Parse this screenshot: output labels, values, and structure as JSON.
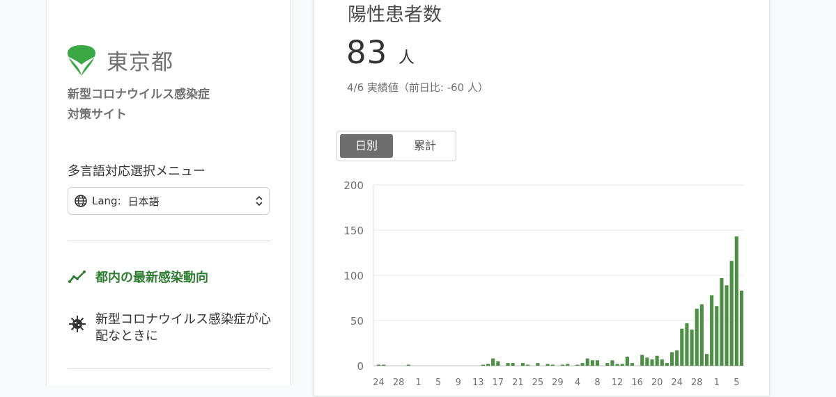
{
  "sidebar": {
    "logo_text": "東京都",
    "site_title_line1": "新型コロナウイルス感染症",
    "site_title_line2": "対策サイト",
    "lang_menu_label": "多言語対応選択メニュー",
    "lang_prefix": "Lang:",
    "lang_value": "日本語",
    "nav_items": [
      {
        "label": "都内の最新感染動向",
        "icon": "trend-line-icon",
        "active": true
      },
      {
        "label": "新型コロナウイルス感染症が心配なときに",
        "icon": "virus-icon",
        "active": false
      }
    ],
    "colors": {
      "logo_green": "#3aa845",
      "active_green": "#2e7d32"
    }
  },
  "card": {
    "title": "陽性患者数",
    "number": "83",
    "unit": "人",
    "note": "4/6 実績値（前日比: -60 人）",
    "toggle": {
      "daily": "日別",
      "cumulative": "累計",
      "selected": "daily"
    }
  },
  "chart_data": {
    "type": "bar",
    "color": "#4e8f46",
    "ylim": [
      0,
      200
    ],
    "yticks": [
      0,
      50,
      100,
      150,
      200
    ],
    "xtick_labels": [
      "24",
      "28",
      "1",
      "5",
      "9",
      "13",
      "17",
      "21",
      "25",
      "29",
      "4",
      "8",
      "12",
      "16",
      "20",
      "24",
      "28",
      "1",
      "5"
    ],
    "values": [
      1,
      1,
      0,
      0,
      0,
      0,
      1,
      0,
      0,
      0,
      0,
      0,
      0,
      0,
      0,
      0,
      0,
      0,
      0,
      0,
      0,
      1,
      2,
      8,
      5,
      0,
      3,
      3,
      0,
      3,
      1,
      0,
      3,
      0,
      2,
      1,
      0,
      1,
      2,
      0,
      1,
      3,
      8,
      6,
      6,
      0,
      3,
      6,
      2,
      2,
      10,
      3,
      0,
      12,
      9,
      7,
      11,
      7,
      3,
      15,
      17,
      41,
      47,
      40,
      63,
      68,
      13,
      78,
      66,
      97,
      89,
      116,
      143,
      83
    ]
  }
}
